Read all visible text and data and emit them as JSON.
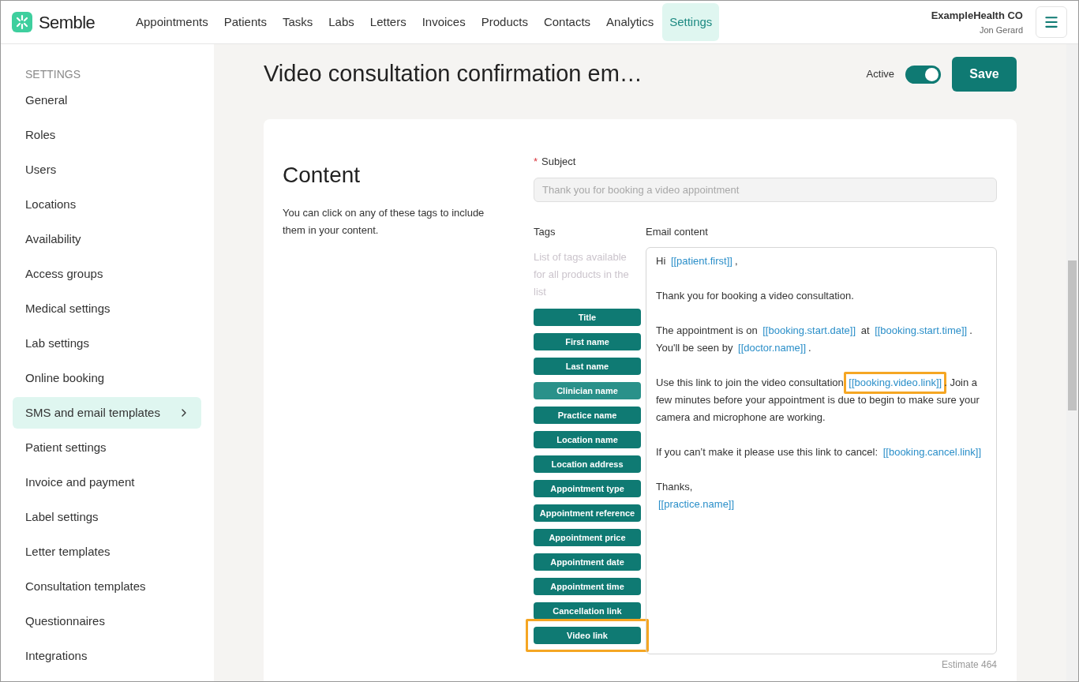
{
  "brand": {
    "name": "Semble"
  },
  "nav": [
    {
      "label": "Appointments",
      "selected": false
    },
    {
      "label": "Patients",
      "selected": false
    },
    {
      "label": "Tasks",
      "selected": false
    },
    {
      "label": "Labs",
      "selected": false
    },
    {
      "label": "Letters",
      "selected": false
    },
    {
      "label": "Invoices",
      "selected": false
    },
    {
      "label": "Products",
      "selected": false
    },
    {
      "label": "Contacts",
      "selected": false
    },
    {
      "label": "Analytics",
      "selected": false
    },
    {
      "label": "Settings",
      "selected": true
    }
  ],
  "account": {
    "organisation": "ExampleHealth CO",
    "user": "Jon Gerard"
  },
  "sidebar": {
    "heading": "SETTINGS",
    "items": [
      {
        "label": "General",
        "selected": false
      },
      {
        "label": "Roles",
        "selected": false
      },
      {
        "label": "Users",
        "selected": false
      },
      {
        "label": "Locations",
        "selected": false
      },
      {
        "label": "Availability",
        "selected": false
      },
      {
        "label": "Access groups",
        "selected": false
      },
      {
        "label": "Medical settings",
        "selected": false
      },
      {
        "label": "Lab settings",
        "selected": false
      },
      {
        "label": "Online booking",
        "selected": false
      },
      {
        "label": "SMS and email templates",
        "selected": true
      },
      {
        "label": "Patient settings",
        "selected": false
      },
      {
        "label": "Invoice and payment",
        "selected": false
      },
      {
        "label": "Label settings",
        "selected": false
      },
      {
        "label": "Letter templates",
        "selected": false
      },
      {
        "label": "Consultation templates",
        "selected": false
      },
      {
        "label": "Questionnaires",
        "selected": false
      },
      {
        "label": "Integrations",
        "selected": false
      }
    ]
  },
  "header": {
    "title": "Video consultation confirmation em…",
    "active_label": "Active",
    "active": true,
    "save": "Save"
  },
  "content": {
    "heading": "Content",
    "description": "You can click on any of these tags to include them in your content.",
    "subject": {
      "required_mark": "*",
      "label": "Subject",
      "placeholder": "Thank you for booking a video appointment"
    },
    "tags": {
      "label": "Tags",
      "hint": "List of tags available for all products in the list",
      "items": [
        {
          "label": "Title",
          "hovered": false,
          "highlighted": false
        },
        {
          "label": "First name",
          "hovered": false,
          "highlighted": false
        },
        {
          "label": "Last name",
          "hovered": false,
          "highlighted": false
        },
        {
          "label": "Clinician name",
          "hovered": true,
          "highlighted": false
        },
        {
          "label": "Practice name",
          "hovered": false,
          "highlighted": false
        },
        {
          "label": "Location name",
          "hovered": false,
          "highlighted": false
        },
        {
          "label": "Location address",
          "hovered": false,
          "highlighted": false
        },
        {
          "label": "Appointment type",
          "hovered": false,
          "highlighted": false
        },
        {
          "label": "Appointment reference",
          "hovered": false,
          "highlighted": false
        },
        {
          "label": "Appointment price",
          "hovered": false,
          "highlighted": false
        },
        {
          "label": "Appointment date",
          "hovered": false,
          "highlighted": false
        },
        {
          "label": "Appointment time",
          "hovered": false,
          "highlighted": false
        },
        {
          "label": "Cancellation link",
          "hovered": false,
          "highlighted": false
        },
        {
          "label": "Video link",
          "hovered": false,
          "highlighted": true
        }
      ]
    },
    "email": {
      "label": "Email content",
      "estimate": "Estimate 464",
      "paragraphs": [
        [
          [
            {
              "kind": "text",
              "text": "Hi "
            },
            {
              "kind": "tag",
              "text": "[[patient.first]]",
              "highlighted": false
            },
            {
              "kind": "text",
              "text": ","
            }
          ]
        ],
        [
          [
            {
              "kind": "text",
              "text": "Thank you for booking a video consultation."
            }
          ]
        ],
        [
          [
            {
              "kind": "text",
              "text": "The appointment is on "
            },
            {
              "kind": "tag",
              "text": "[[booking.start.date]]",
              "highlighted": false
            },
            {
              "kind": "text",
              "text": " at "
            },
            {
              "kind": "tag",
              "text": "[[booking.start.time]]",
              "highlighted": false
            },
            {
              "kind": "text",
              "text": "."
            }
          ],
          [
            {
              "kind": "text",
              "text": "You'll be seen by "
            },
            {
              "kind": "tag",
              "text": "[[doctor.name]]",
              "highlighted": false
            },
            {
              "kind": "text",
              "text": "."
            }
          ]
        ],
        [
          [
            {
              "kind": "text",
              "text": "Use this link to join the video consultation "
            },
            {
              "kind": "tag",
              "text": "[[booking.video.link]]",
              "highlighted": true
            },
            {
              "kind": "text",
              "text": ". Join a few minutes before your appointment is due to begin to make sure your camera and microphone are working."
            }
          ]
        ],
        [
          [
            {
              "kind": "text",
              "text": "If you can’t make it please use this link to cancel: "
            },
            {
              "kind": "tag",
              "text": "[[booking.cancel.link]]",
              "highlighted": false
            }
          ]
        ],
        [
          [
            {
              "kind": "text",
              "text": "Thanks,"
            }
          ],
          [
            {
              "kind": "tag",
              "text": "[[practice.name]]",
              "highlighted": false
            }
          ]
        ]
      ]
    }
  }
}
